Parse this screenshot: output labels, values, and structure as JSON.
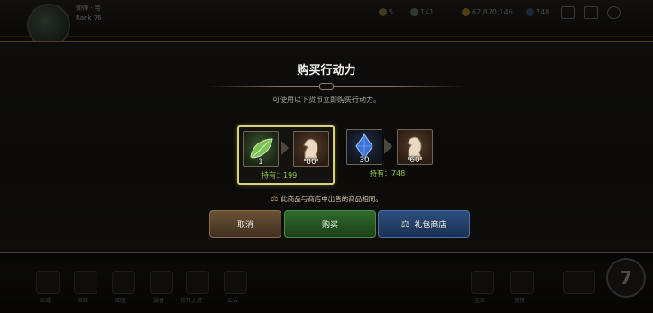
{
  "hud": {
    "player_name": "帅帅 · 宅",
    "player_level": "Rank 76",
    "resources": [
      {
        "icon": "action-point-icon",
        "value": "5"
      },
      {
        "icon": "stamina-icon",
        "value": "141"
      },
      {
        "icon": "gold-coin-icon",
        "value": "62,870,146"
      },
      {
        "icon": "gem-icon",
        "value": "748"
      }
    ],
    "bottom_menu": [
      "商城",
      "英雄",
      "图鉴",
      "装备",
      "修行之塔",
      "公会",
      "宝库",
      "竞技"
    ],
    "corner_badge": "7"
  },
  "dialog": {
    "title": "购买行动力",
    "subtitle": "可使用以下货币立即购买行动力。",
    "options": [
      {
        "cost_item_icon": "leaf-icon",
        "cost_amount": "1",
        "reward_icon": "chess-knight-icon",
        "reward_amount": "80",
        "owned_label": "持有：199",
        "selected": true
      },
      {
        "cost_item_icon": "blue-crystal-icon",
        "cost_amount": "30",
        "reward_icon": "chess-knight-icon",
        "reward_amount": "60",
        "owned_label": "持有：748",
        "selected": false
      }
    ],
    "notice": "此商品与商店中出售的商品相同。",
    "buttons": {
      "cancel": "取消",
      "buy": "购买",
      "gift_shop": "礼包商店"
    }
  },
  "colors": {
    "selected_border": "#d8d27a",
    "owned_text": "#8fca3a",
    "buy_button": "#2f6a2c",
    "cancel_button": "#6a5235",
    "shop_button": "#2d4f80"
  }
}
